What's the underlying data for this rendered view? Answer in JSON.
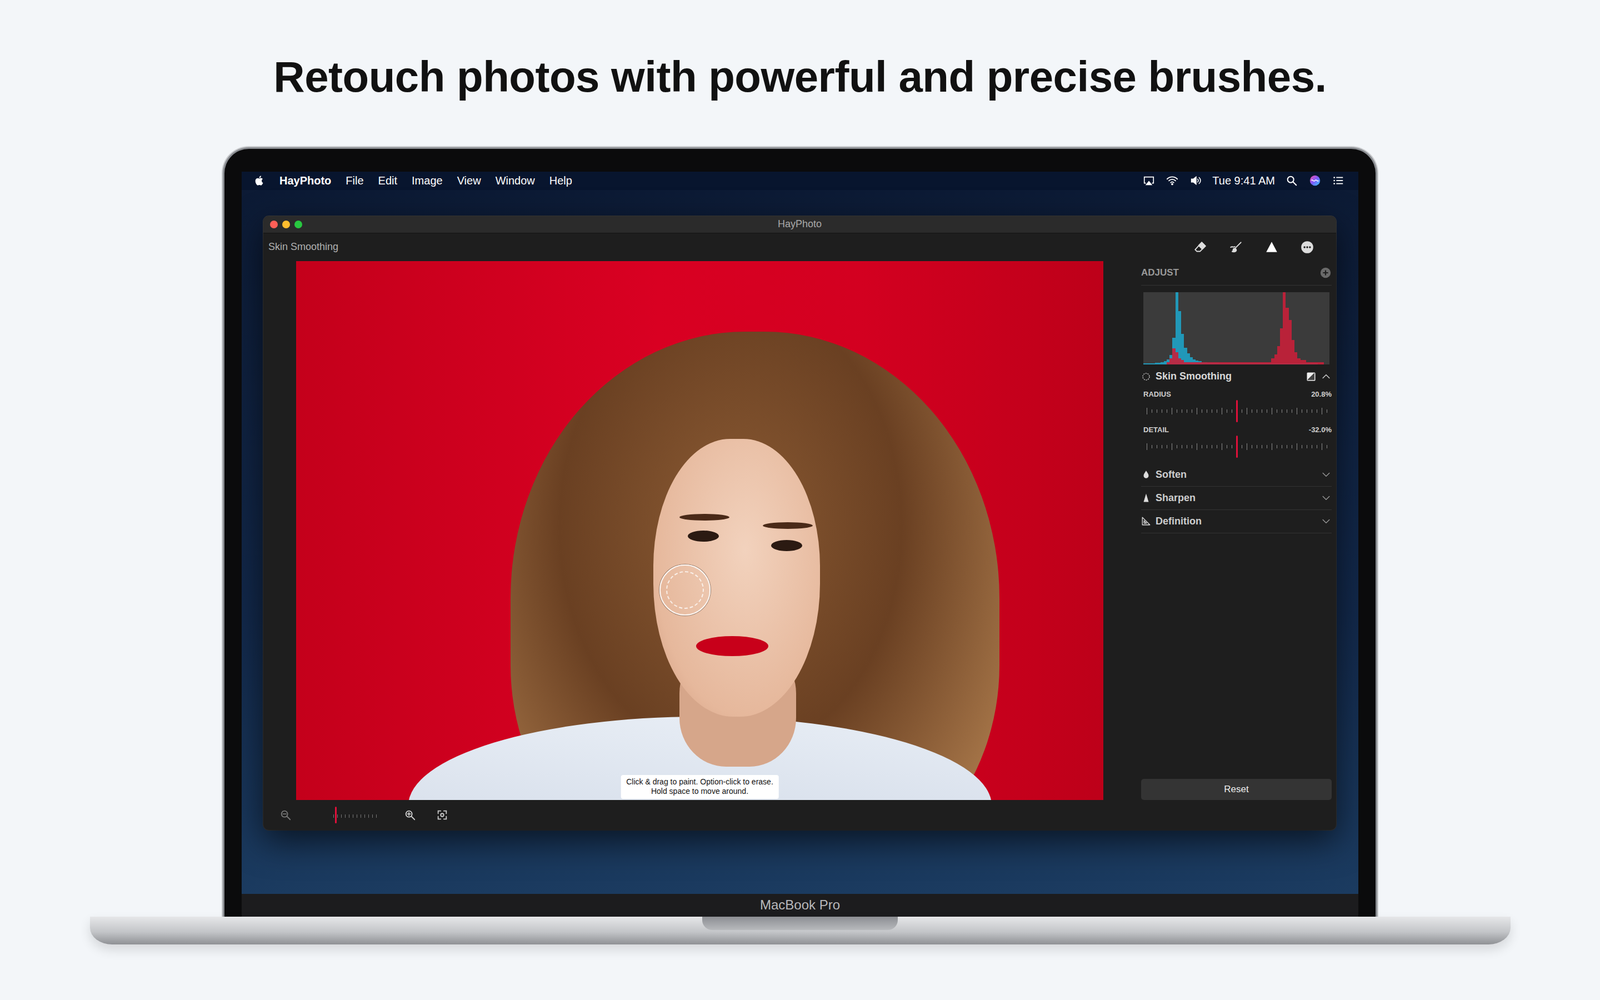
{
  "headline": "Retouch photos with powerful and precise brushes.",
  "menubar": {
    "items": [
      {
        "label": "HayPhoto",
        "kind": "app"
      },
      {
        "label": "File",
        "kind": "menu"
      },
      {
        "label": "Edit",
        "kind": "menu"
      },
      {
        "label": "Image",
        "kind": "menu"
      },
      {
        "label": "View",
        "kind": "menu"
      },
      {
        "label": "Window",
        "kind": "menu"
      },
      {
        "label": "Help",
        "kind": "menu"
      }
    ],
    "clock": "Tue 9:41 AM"
  },
  "window": {
    "title": "HayPhoto",
    "tool": "Skin Smoothing"
  },
  "canvas": {
    "tooltip": [
      "Click & drag to paint. Option-click to erase.",
      "Hold space to move around."
    ],
    "zoom": {
      "level": 0.05
    }
  },
  "panel": {
    "title": "ADJUST",
    "histogram": {
      "series": [
        {
          "color": "#1fa3c6",
          "values": [
            1,
            1,
            1,
            1,
            2,
            2,
            3,
            4,
            6,
            12,
            35,
            95,
            70,
            40,
            22,
            14,
            9,
            6,
            5,
            4,
            3,
            3,
            2,
            2,
            2,
            2,
            1,
            1,
            1,
            1,
            1,
            1,
            1,
            1,
            1,
            1,
            1,
            1,
            1,
            1,
            1,
            1,
            1,
            1,
            1,
            1,
            1,
            1,
            1,
            1,
            1,
            1,
            1,
            1,
            1,
            1,
            1,
            1,
            1,
            1,
            0,
            0,
            0,
            0
          ]
        },
        {
          "color": "#c8203a",
          "values": [
            0,
            0,
            0,
            0,
            0,
            0,
            0,
            0,
            1,
            3,
            8,
            6,
            3,
            2,
            1,
            1,
            1,
            1,
            1,
            1,
            1,
            1,
            1,
            1,
            1,
            1,
            1,
            1,
            1,
            1,
            1,
            1,
            1,
            1,
            1,
            1,
            1,
            1,
            1,
            1,
            1,
            1,
            1,
            1,
            3,
            5,
            9,
            18,
            36,
            28,
            22,
            12,
            6,
            3,
            2,
            2,
            1,
            1,
            1,
            1,
            1,
            1,
            0,
            0
          ]
        }
      ]
    },
    "adjustment": {
      "label": "Skin Smoothing",
      "expanded": true,
      "sliders": [
        {
          "label": "RADIUS",
          "reading": "20.8%",
          "level": 0.49
        },
        {
          "label": "DETAIL",
          "reading": "-32.0%",
          "level": 0.49
        }
      ]
    },
    "sections": [
      {
        "label": "Soften",
        "expanded": false
      },
      {
        "label": "Sharpen",
        "expanded": false
      },
      {
        "label": "Definition",
        "expanded": false
      }
    ],
    "reset": "Reset"
  },
  "laptop": {
    "label": "MacBook Pro"
  }
}
